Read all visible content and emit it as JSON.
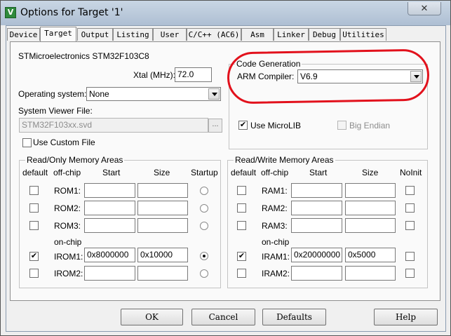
{
  "window": {
    "title": "Options for Target '1'",
    "icon_glyph": "V",
    "close_glyph": "✕"
  },
  "tabs": [
    "Device",
    "Target",
    "Output",
    "Listing",
    "User",
    "C/C++ (AC6)",
    "Asm",
    "Linker",
    "Debug",
    "Utilities"
  ],
  "active_tab": "Target",
  "device_name": "STMicroelectronics STM32F103C8",
  "xtal": {
    "label": "Xtal (MHz):",
    "value": "72.0"
  },
  "os": {
    "label": "Operating system:",
    "value": "None"
  },
  "svd": {
    "label": "System Viewer File:",
    "value": "STM32F103xx.svd",
    "browse": "..."
  },
  "use_custom_file": {
    "label": "Use Custom File",
    "checked": false
  },
  "code_generation": {
    "title": "Code Generation",
    "compiler_label": "ARM Compiler:",
    "compiler_value": "V6.9",
    "use_microlib": {
      "label": "Use MicroLIB",
      "checked": true
    },
    "big_endian": {
      "label": "Big Endian",
      "checked": false,
      "enabled": false
    }
  },
  "ro_memory": {
    "title": "Read/Only Memory Areas",
    "headers": {
      "default": "default",
      "offchip": "off-chip",
      "start": "Start",
      "size": "Size",
      "startup": "Startup"
    },
    "onchip_label": "on-chip",
    "rows": [
      {
        "name": "ROM1:",
        "default": false,
        "start": "",
        "size": "",
        "startup": false
      },
      {
        "name": "ROM2:",
        "default": false,
        "start": "",
        "size": "",
        "startup": false
      },
      {
        "name": "ROM3:",
        "default": false,
        "start": "",
        "size": "",
        "startup": false
      },
      {
        "name": "IROM1:",
        "default": true,
        "start": "0x8000000",
        "size": "0x10000",
        "startup": true
      },
      {
        "name": "IROM2:",
        "default": false,
        "start": "",
        "size": "",
        "startup": false
      }
    ]
  },
  "rw_memory": {
    "title": "Read/Write Memory Areas",
    "headers": {
      "default": "default",
      "offchip": "off-chip",
      "start": "Start",
      "size": "Size",
      "noinit": "NoInit"
    },
    "onchip_label": "on-chip",
    "rows": [
      {
        "name": "RAM1:",
        "default": false,
        "start": "",
        "size": "",
        "noinit": false
      },
      {
        "name": "RAM2:",
        "default": false,
        "start": "",
        "size": "",
        "noinit": false
      },
      {
        "name": "RAM3:",
        "default": false,
        "start": "",
        "size": "",
        "noinit": false
      },
      {
        "name": "IRAM1:",
        "default": true,
        "start": "0x20000000",
        "size": "0x5000",
        "noinit": false
      },
      {
        "name": "IRAM2:",
        "default": false,
        "start": "",
        "size": "",
        "noinit": false
      }
    ]
  },
  "buttons": {
    "ok": "OK",
    "cancel": "Cancel",
    "defaults": "Defaults",
    "help": "Help"
  },
  "check_glyph": "✔",
  "colors": {
    "highlight": "#e2111c",
    "titlebar": "#b9c8da"
  }
}
